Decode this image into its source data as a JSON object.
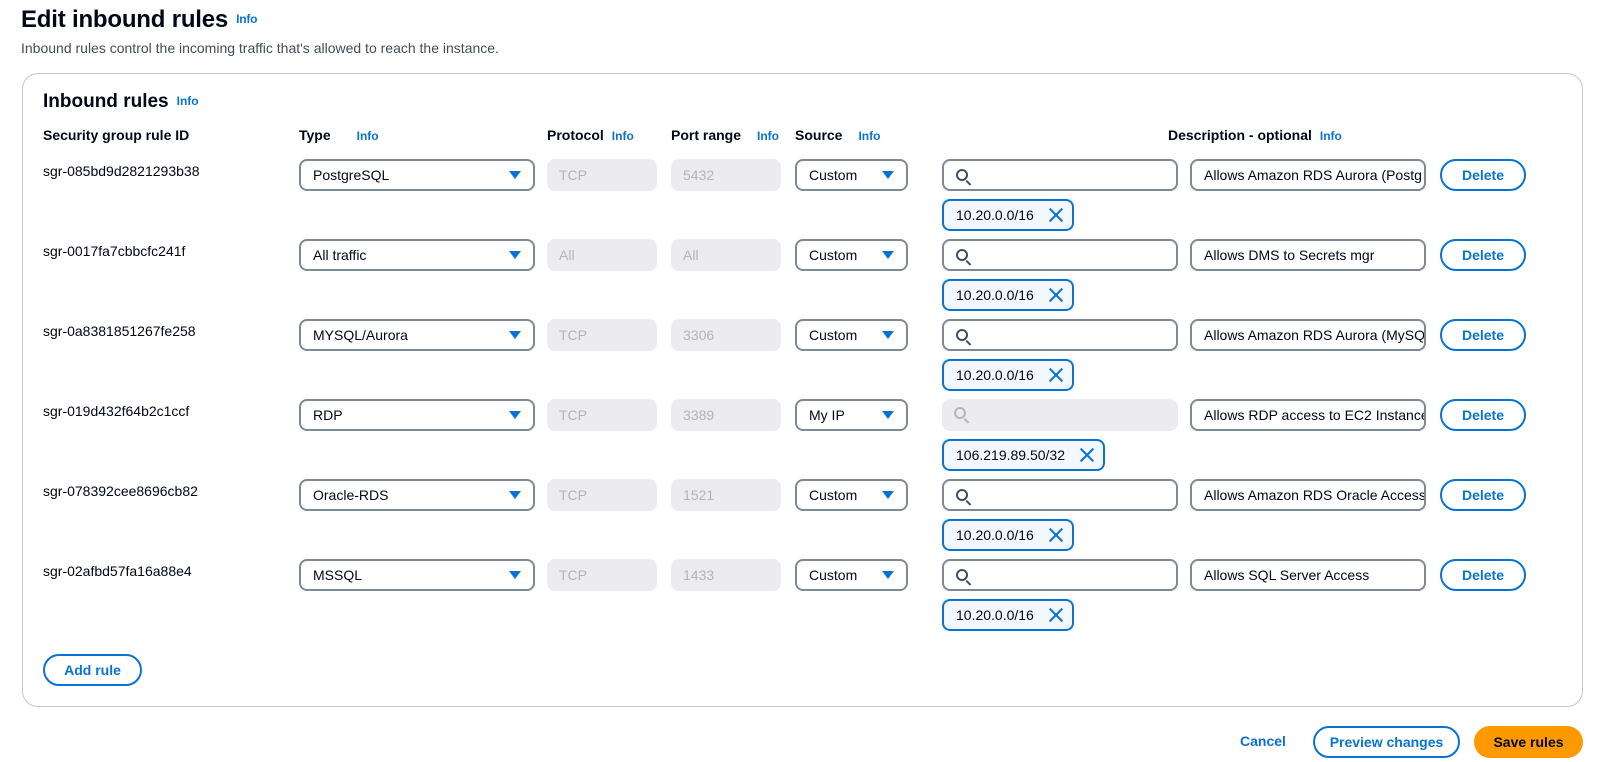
{
  "header": {
    "title": "Edit inbound rules",
    "info": "Info",
    "description": "Inbound rules control the incoming traffic that's allowed to reach the instance."
  },
  "panel": {
    "title": "Inbound rules",
    "info": "Info"
  },
  "columns": {
    "rule_id": "Security group rule ID",
    "type": "Type",
    "protocol": "Protocol",
    "port_range": "Port range",
    "source": "Source",
    "description": "Description - optional",
    "info": "Info"
  },
  "rules": [
    {
      "id": "sgr-085bd9d2821293b38",
      "type": "PostgreSQL",
      "protocol": "TCP",
      "port": "5432",
      "source": "Custom",
      "cidr": "10.20.0.0/16",
      "description": "Allows Amazon RDS Aurora (Postg",
      "delete": "Delete"
    },
    {
      "id": "sgr-0017fa7cbbcfc241f",
      "type": "All traffic",
      "protocol": "All",
      "port": "All",
      "source": "Custom",
      "cidr": "10.20.0.0/16",
      "description": "Allows DMS to Secrets mgr",
      "delete": "Delete"
    },
    {
      "id": "sgr-0a8381851267fe258",
      "type": "MYSQL/Aurora",
      "protocol": "TCP",
      "port": "3306",
      "source": "Custom",
      "cidr": "10.20.0.0/16",
      "description": "Allows Amazon RDS Aurora (MySQ",
      "delete": "Delete"
    },
    {
      "id": "sgr-019d432f64b2c1ccf",
      "type": "RDP",
      "protocol": "TCP",
      "port": "3389",
      "source": "My IP",
      "cidr": "106.219.89.50/32",
      "description": "Allows RDP access to EC2 Instance",
      "delete": "Delete"
    },
    {
      "id": "sgr-078392cee8696cb82",
      "type": "Oracle-RDS",
      "protocol": "TCP",
      "port": "1521",
      "source": "Custom",
      "cidr": "10.20.0.0/16",
      "description": "Allows Amazon RDS Oracle Access",
      "delete": "Delete"
    },
    {
      "id": "sgr-02afbd57fa16a88e4",
      "type": "MSSQL",
      "protocol": "TCP",
      "port": "1433",
      "source": "Custom",
      "cidr": "10.20.0.0/16",
      "description": "Allows SQL Server Access",
      "delete": "Delete"
    }
  ],
  "add_rule": "Add rule",
  "footer": {
    "cancel": "Cancel",
    "preview": "Preview changes",
    "save": "Save rules"
  },
  "colors": {
    "accent": "#0972d3",
    "primary_button": "#ff9900",
    "border": "#7d8998",
    "disabled_bg": "#ebebf0"
  },
  "icons": {
    "dropdown": "caret-down-icon",
    "search": "search-icon",
    "remove_token": "close-icon"
  }
}
